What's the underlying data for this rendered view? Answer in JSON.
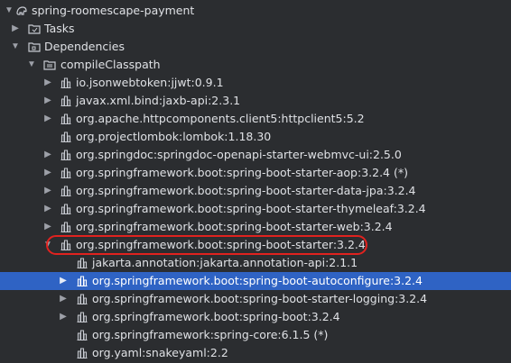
{
  "project": {
    "name": "spring-roomescape-payment",
    "icon": "gradle-elephant-icon"
  },
  "tasks_label": "Tasks",
  "dependencies_label": "Dependencies",
  "config_label": "compileClasspath",
  "deps": [
    "io.jsonwebtoken:jjwt:0.9.1",
    "javax.xml.bind:jaxb-api:2.3.1",
    "org.apache.httpcomponents.client5:httpclient5:5.2",
    "org.projectlombok:lombok:1.18.30",
    "org.springdoc:springdoc-openapi-starter-webmvc-ui:2.5.0",
    "org.springframework.boot:spring-boot-starter-aop:3.2.4 (*)",
    "org.springframework.boot:spring-boot-starter-data-jpa:3.2.4",
    "org.springframework.boot:spring-boot-starter-thymeleaf:3.2.4",
    "org.springframework.boot:spring-boot-starter-web:3.2.4",
    "org.springframework.boot:spring-boot-starter:3.2.4"
  ],
  "children": [
    "jakarta.annotation:jakarta.annotation-api:2.1.1",
    "org.springframework.boot:spring-boot-autoconfigure:3.2.4",
    "org.springframework.boot:spring-boot-starter-logging:3.2.4",
    "org.springframework.boot:spring-boot:3.2.4",
    "org.springframework:spring-core:6.1.5 (*)",
    "org.yaml:snakeyaml:2.2"
  ],
  "colors": {
    "background": "#2b2d30",
    "selection": "#2f63c4",
    "highlight": "#e0221f"
  }
}
